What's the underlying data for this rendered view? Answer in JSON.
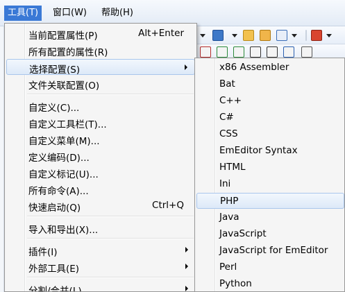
{
  "menubar": {
    "tools": "工具(T)",
    "window": "窗口(W)",
    "help": "帮助(H)"
  },
  "tools_menu": {
    "current_props": "当前配置属性(P)",
    "current_props_shortcut": "Alt+Enter",
    "all_props": "所有配置的属性(R)",
    "select_config": "选择配置(S)",
    "file_assoc": "文件关联配置(O)",
    "customize": "自定义(C)...",
    "customize_toolbar": "自定义工具栏(T)...",
    "customize_menu": "自定义菜单(M)...",
    "define_encoding": "定义编码(D)...",
    "customize_marker": "自定义标记(U)...",
    "all_commands": "所有命令(A)...",
    "quick_launch": "快速启动(Q)",
    "quick_launch_shortcut": "Ctrl+Q",
    "import_export": "导入和导出(X)...",
    "plugins": "插件(I)",
    "external_tools": "外部工具(E)",
    "split_merge": "分割/合并(L)"
  },
  "config_submenu": {
    "items": [
      "x86 Assembler",
      "Bat",
      "C++",
      "C#",
      "CSS",
      "EmEditor Syntax",
      "HTML",
      "Ini",
      "PHP",
      "Java",
      "JavaScript",
      "JavaScript for EmEditor",
      "Perl",
      "Python"
    ],
    "highlighted": "PHP"
  },
  "colors": {
    "menu_active": "#3a79d6",
    "highlight_border": "#a9c6ec"
  }
}
